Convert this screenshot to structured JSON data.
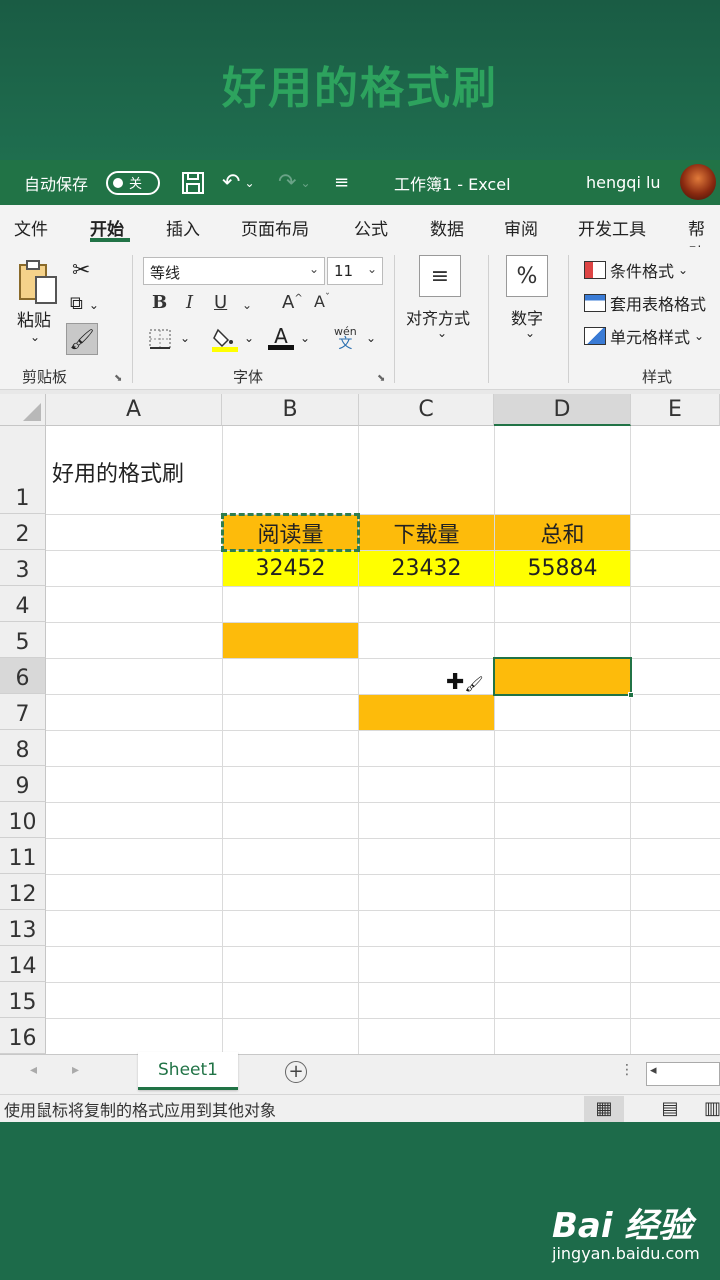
{
  "banner": {
    "title": "好用的格式刷"
  },
  "titlebar": {
    "autosave_label": "自动保存",
    "autosave_state": "关",
    "save_icon": "save-icon",
    "undo_icon": "undo-icon",
    "redo_icon": "redo-icon",
    "customize_icon": "customize-icon",
    "document_title": "工作簿1  -  Excel",
    "user_name": "hengqi lu"
  },
  "ribbon_tabs": [
    "文件",
    "开始",
    "插入",
    "页面布局",
    "公式",
    "数据",
    "审阅",
    "开发工具",
    "帮助"
  ],
  "active_tab": "开始",
  "ribbon": {
    "clipboard": {
      "paste_label": "粘贴",
      "group_label": "剪贴板"
    },
    "font": {
      "name": "等线",
      "size": "11",
      "group_label": "字体",
      "bold": "B",
      "italic": "I",
      "underline": "U",
      "grow": "A",
      "shrink": "A",
      "phonetic_top": "wén",
      "phonetic_bottom": "文"
    },
    "alignment": {
      "label": "对齐方式"
    },
    "number": {
      "icon_label": "%",
      "label": "数字"
    },
    "styles": {
      "conditional": "条件格式",
      "table_format": "套用表格格式",
      "cell_styles": "单元格样式",
      "group_label": "样式"
    }
  },
  "sheet": {
    "columns": [
      "A",
      "B",
      "C",
      "D",
      "E"
    ],
    "selected_column": "D",
    "rows": [
      "1",
      "2",
      "3",
      "4",
      "5",
      "6",
      "7",
      "8",
      "9",
      "10",
      "11",
      "12",
      "13",
      "14",
      "15",
      "16"
    ],
    "selected_row": "6",
    "a1": "好用的格式刷",
    "header_row": [
      "阅读量",
      "下载量",
      "总和"
    ],
    "value_row": [
      "32452",
      "23432",
      "55884"
    ],
    "colors": {
      "orange": "#fdbb0b",
      "yellow": "#ffff00",
      "accent": "#217346"
    }
  },
  "sheet_tab": "Sheet1",
  "status_text": "使用鼠标将复制的格式应用到其他对象",
  "watermark": {
    "brand": "Bai  经验",
    "url": "jingyan.baidu.com"
  }
}
